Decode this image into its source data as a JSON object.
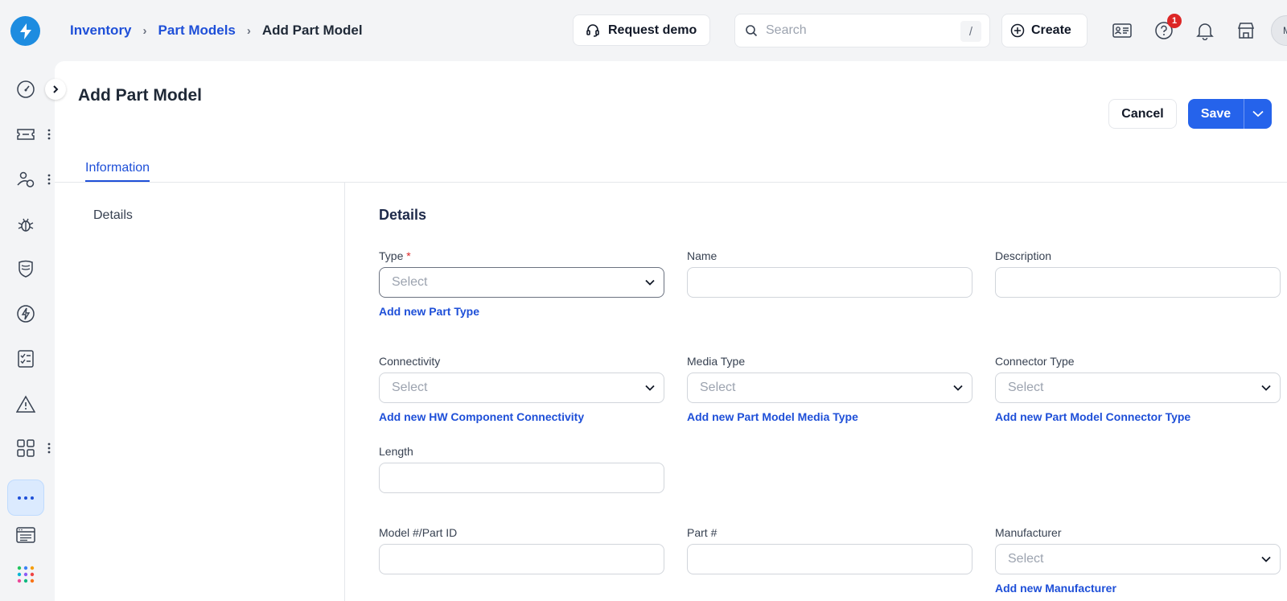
{
  "breadcrumb": {
    "items": [
      "Inventory",
      "Part Models"
    ],
    "current": "Add Part Model",
    "separator": "›"
  },
  "topbar": {
    "request_demo_label": "Request demo",
    "search_placeholder": "Search",
    "search_shortcut": "/",
    "create_label": "Create",
    "help_badge_count": "1",
    "avatar_initial": "M"
  },
  "page": {
    "title": "Add Part Model",
    "cancel_label": "Cancel",
    "save_label": "Save",
    "tabs": [
      "Information"
    ],
    "left_nav": [
      "Details"
    ]
  },
  "form": {
    "section_title": "Details",
    "required_mark": "*",
    "fields": {
      "type": {
        "label": "Type",
        "placeholder": "Select",
        "add_link": "Add new Part Type"
      },
      "name": {
        "label": "Name",
        "value": ""
      },
      "description": {
        "label": "Description",
        "value": ""
      },
      "connectivity": {
        "label": "Connectivity",
        "placeholder": "Select",
        "add_link": "Add new HW Component Connectivity"
      },
      "media_type": {
        "label": "Media Type",
        "placeholder": "Select",
        "add_link": "Add new Part Model Media Type"
      },
      "connector_type": {
        "label": "Connector Type",
        "placeholder": "Select",
        "add_link": "Add new Part Model Connector Type"
      },
      "length": {
        "label": "Length",
        "value": ""
      },
      "model_part_id": {
        "label": "Model #/Part ID",
        "value": ""
      },
      "part_number": {
        "label": "Part #",
        "value": ""
      },
      "manufacturer": {
        "label": "Manufacturer",
        "placeholder": "Select",
        "add_link": "Add new Manufacturer"
      }
    }
  },
  "sidebar": {
    "icons": [
      "dashboard-icon",
      "tickets-icon",
      "users-icon",
      "bug-icon",
      "shield-icon",
      "changes-icon",
      "tasks-icon",
      "alert-icon",
      "apps-icon",
      "more-icon",
      "catalog-icon",
      "app-grid-icon"
    ]
  },
  "colors": {
    "accent": "#2563eb",
    "link": "#1e4fd8",
    "logo": "#1d8ce0",
    "badge": "#dc2626",
    "page_bg": "#f3f4f6"
  }
}
